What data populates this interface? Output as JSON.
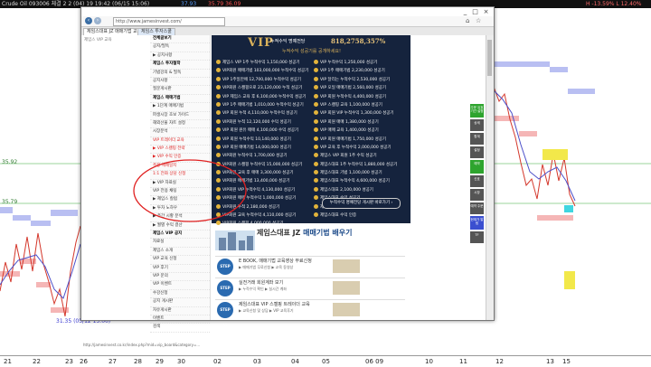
{
  "header": {
    "left_text": "Crude Oil 093006  체결 2  2 (04) 19  19:42   (06/15  15:06)",
    "price_a": "37.93",
    "price_b": "35.79 36.09",
    "right_text": "H  -13.59%   L  12.40%"
  },
  "chart": {
    "y_labels": [
      "35.92",
      "35.79"
    ],
    "bottom_label": "31.35 (05/12 13:00)",
    "x_labels": [
      "21",
      "22",
      "23",
      "26",
      "27",
      "28",
      "29",
      "30",
      "02",
      "03",
      "04",
      "05",
      "06 09",
      "10",
      "11",
      "12",
      "13",
      "15"
    ],
    "colors": {
      "band": "#b9bff2",
      "lower_band": "#f5b6b6",
      "price": "#d4382c",
      "ma": "#4b4fc9",
      "accent": "#2ea42e"
    }
  },
  "browser": {
    "url": "http://www.jamesinvest.com/",
    "tabs": [
      "체임스대표 JZ 매매기법 교육",
      "체임스 투자스쿨"
    ],
    "win_buttons": [
      "_",
      "□",
      "×"
    ],
    "status_url": "http://jamesinvest.co.kr/index.php?mid=vip_board&category=..."
  },
  "left_panel": {
    "label": "제임스 VIP 교육"
  },
  "sidebar": {
    "items": [
      {
        "label": "전체글보기",
        "style": "h"
      },
      {
        "label": "공지/필독",
        "style": ""
      },
      {
        "label": "▶ 공지사항",
        "style": ""
      },
      {
        "label": "제임스 투자철학",
        "style": "h"
      },
      {
        "label": "기법강의 & 필독",
        "style": ""
      },
      {
        "label": "공지사항",
        "style": ""
      },
      {
        "label": "질문게시판",
        "style": ""
      },
      {
        "label": "제임스 매매기법",
        "style": "h"
      },
      {
        "label": "▶ 1단계 매매기법",
        "style": ""
      },
      {
        "label": "파생시장 초보 가이드",
        "style": ""
      },
      {
        "label": "해외선물 차트 설정",
        "style": ""
      },
      {
        "label": "시장분석",
        "style": ""
      },
      {
        "label": "VIP 트레이더 교육",
        "style": "r"
      },
      {
        "label": "▶ VIP 스캘핑 전략",
        "style": "r"
      },
      {
        "label": "▶ VIP 수익 인증",
        "style": "r"
      },
      {
        "label": "주봉 매매일지",
        "style": "r"
      },
      {
        "label": "1:1 전화 상담 신청",
        "style": "r"
      },
      {
        "label": "▶ VIP 자료실",
        "style": ""
      },
      {
        "label": "VIP 전용 채팅",
        "style": ""
      },
      {
        "label": "▶ 제임스 칼럼",
        "style": ""
      },
      {
        "label": "▶ 투자 노하우",
        "style": ""
      },
      {
        "label": "▶ 주간 시황 분석",
        "style": ""
      },
      {
        "label": "▶ 월별 수익 결산",
        "style": ""
      },
      {
        "label": "제임스 VIP 공지",
        "style": "h"
      },
      {
        "label": "자료실",
        "style": ""
      },
      {
        "label": "제임스 소개",
        "style": ""
      },
      {
        "label": "VIP 교육 신청",
        "style": ""
      },
      {
        "label": "VIP 후기",
        "style": ""
      },
      {
        "label": "VIP 문의",
        "style": ""
      },
      {
        "label": "VIP 이벤트",
        "style": ""
      },
      {
        "label": "수강신청",
        "style": ""
      },
      {
        "label": "공지 게시판",
        "style": ""
      },
      {
        "label": "자유게시판",
        "style": ""
      },
      {
        "label": "이벤트",
        "style": ""
      },
      {
        "label": "검색",
        "style": ""
      }
    ]
  },
  "vip": {
    "title": "VIP",
    "subtitle": "누적수익 명예전당",
    "amount": "818,2758,357%",
    "tag": "누적수익 성공기를 공개하세요!",
    "rows": [
      [
        "제임스 VIP 1주 누적수익 1,150,000 성공기",
        "VIP 누적수익 1,250,000 성공기"
      ],
      [
        "VIP회원 매매기법 103,000,000 누적수익 성공기",
        "VIP 1주 매매기법 2,230,000 성공기"
      ],
      [
        "VIP 1주일만에 12,700,000 누적수익 성공기",
        "VIP 달리는 누적수익 2,530,000 성공기"
      ],
      [
        "VIP회원 스캘핑으로 23,120,000 누적 성공기",
        "VIP 오일 매매기법 2,560,000 성공기"
      ],
      [
        "VIP 제임스 교육 후 6,100,000 누적수익 성공기",
        "VIP 회원 누적수익 4,400,000 성공기"
      ],
      [
        "VIP 1주 매매기법 1,010,000 누적수익 성공기",
        "VIP 스캘핑 교육 1,100,000 성공기"
      ],
      [
        "VIP 회원 누적 4,110,000 누적수익 성공기",
        "VIP 회원 VIP 누적수익 1,300,000 성공기"
      ],
      [
        "VIP회원 누적 12,120,000 수익 성공기",
        "VIP 회원 매매 1,380,000 성공기"
      ],
      [
        "VIP 회원 원유 매매 4,100,000 수익 성공기",
        "VIP 매매 교육 1,400,000 성공기"
      ],
      [
        "VIP 회원 누적수익 10,140,000 성공기",
        "VIP 회원 매매기법 1,750,000 성공기"
      ],
      [
        "VIP 회원 매매기법 14,000,000 성공기",
        "VIP 교육 후 누적수익 2,000,000 성공기"
      ],
      [
        "VIP회원 누적수익 1,700,000 성공기",
        "제임스 VIP 회원 1주 수익 성공기"
      ],
      [
        "VIP회원 스캘핑 누적수익 15,000,000 성공기",
        "제임스대표 1주 누적수익 1,880,000 성공기"
      ],
      [
        "VIP회원 교육 후 매매 3,300,000 성공기",
        "제임스대표 기법 1,100,000 성공기"
      ],
      [
        "VIP회원 매매기법 13,400,000 성공기",
        "제임스대표 누적수익 4,600,000 성공기"
      ],
      [
        "VIP회원 VIP 누적수익 4,130,000 성공기",
        "제임스대표 2,100,000 성공기"
      ],
      [
        "VIP회원 매매 누적수익 1,000,000 성공기",
        "제임스대표 수익 성공기"
      ],
      [
        "VIP회원 누적 2,180,000 성공기",
        "제임스대표 누적 3,200,000 성공기"
      ],
      [
        "VIP회원 교육 누적수익 4,110,000 성공기",
        "제임스대표 수익 인증"
      ],
      [
        "VIP회원 스캘핑 4,000,000 성공기",
        ""
      ],
      [
        "VIP회원 원유 1,230,000 성공기",
        ""
      ]
    ],
    "more_button": "누적수익 명예전당 게시판 바로가기 ›"
  },
  "lower": {
    "title_a": "제임스대표 JZ ",
    "title_b": "매매기법 배우기",
    "steps": [
      {
        "badge": "STEP 01",
        "text": "E BOOK, 매매기법 교육영상 무료신청",
        "sub": "▶ 매매기법 무료신청     ▶ 교육 동영상"
      },
      {
        "badge": "STEP 02",
        "text": "실전거래 회원계좌 보기",
        "sub": "▶ 누적수익 확인     ▶ 실시간 계좌"
      },
      {
        "badge": "STEP 03",
        "text": "제임스대표 VIP 스캘핑 트레이더 교육",
        "sub": "▶ 교육신청 및 상담     ▶ VIP 교육후기"
      }
    ]
  },
  "right_toolbar": {
    "buttons": [
      {
        "label": "주문 유효기간 설정",
        "color": "#2ea42e"
      },
      {
        "label": "상세",
        "color": "#555"
      },
      {
        "label": "합계",
        "color": "#555"
      },
      {
        "label": "설정",
        "color": "#555"
      },
      {
        "label": "예약",
        "color": "#2ea42e"
      },
      {
        "label": "신호",
        "color": "#555"
      },
      {
        "label": "시장",
        "color": "#555"
      },
      {
        "label": "예약 주문",
        "color": "#555"
      },
      {
        "label": "현재가 알림",
        "color": "#3b4fd0"
      },
      {
        "label": "TF",
        "color": "#555"
      }
    ]
  }
}
